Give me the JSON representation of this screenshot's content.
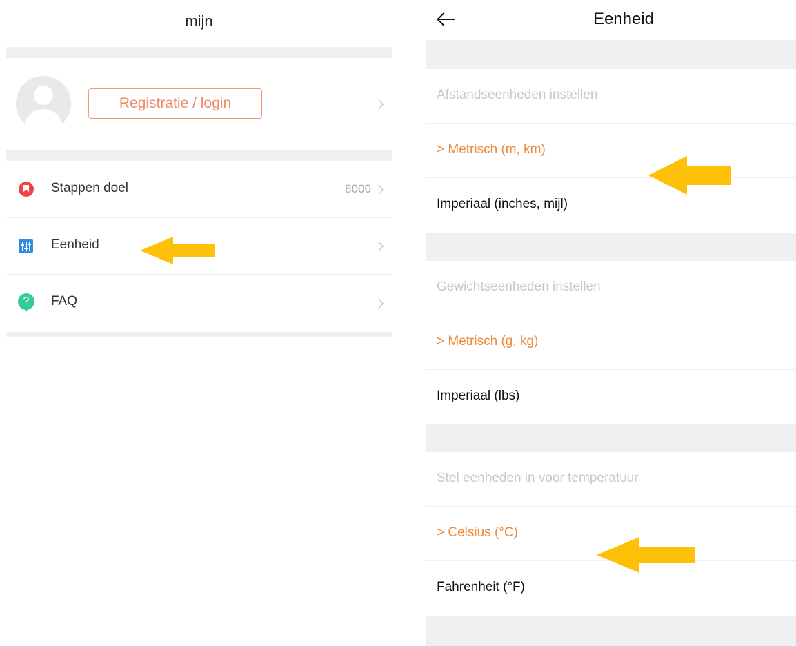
{
  "left": {
    "title": "mijn",
    "login_label": "Registratie / login",
    "items": [
      {
        "label": "Stappen doel",
        "value": "8000",
        "icon": "bookmark-icon"
      },
      {
        "label": "Eenheid",
        "value": "",
        "icon": "sliders-icon"
      },
      {
        "label": "FAQ",
        "value": "",
        "icon": "question-icon",
        "icon_glyph": "?"
      }
    ]
  },
  "right": {
    "title": "Eenheid",
    "distance": {
      "header": "Afstandseenheden instellen",
      "options": [
        {
          "label": "> Metrisch (m, km)",
          "selected": true
        },
        {
          "label": "Imperiaal (inches, mijl)",
          "selected": false
        }
      ]
    },
    "weight": {
      "header": "Gewichtseenheden instellen",
      "options": [
        {
          "label": "> Metrisch (g, kg)",
          "selected": true
        },
        {
          "label": "Imperiaal (lbs)",
          "selected": false
        }
      ]
    },
    "temperature": {
      "header": "Stel eenheden in voor temperatuur",
      "options": [
        {
          "label": "> Celsius  (°C)",
          "selected": true
        },
        {
          "label": "Fahrenheit (°F)",
          "selected": false
        }
      ]
    }
  },
  "colors": {
    "accent_orange": "#ef8a3a",
    "login_border": "#f09a7c",
    "annotation_yellow": "#ffc107",
    "section_band": "#f0f0f0"
  }
}
